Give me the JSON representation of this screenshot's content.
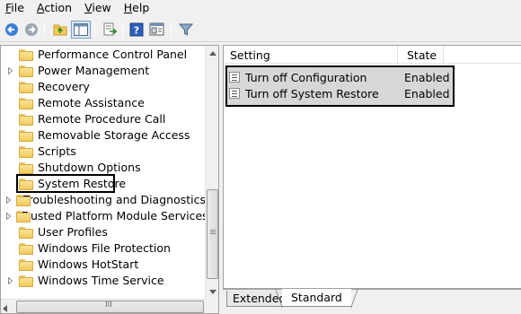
{
  "menu": [
    {
      "label": "File",
      "underline": "F",
      "rest": "ile"
    },
    {
      "label": "Action",
      "underline": "A",
      "rest": "ction"
    },
    {
      "label": "View",
      "underline": "V",
      "rest": "iew"
    },
    {
      "label": "Help",
      "underline": "H",
      "rest": "elp"
    }
  ],
  "toolbar": {
    "buttons": [
      "back-icon",
      "forward-icon",
      "up-folder-icon",
      "show-hide-tree-icon",
      "export-list-icon",
      "help-icon",
      "properties-icon",
      "filter-icon"
    ]
  },
  "tree": {
    "items": [
      {
        "label": "Performance Control Panel",
        "expandable": false
      },
      {
        "label": "Power Management",
        "expandable": true
      },
      {
        "label": "Recovery",
        "expandable": false
      },
      {
        "label": "Remote Assistance",
        "expandable": false
      },
      {
        "label": "Remote Procedure Call",
        "expandable": false
      },
      {
        "label": "Removable Storage Access",
        "expandable": false
      },
      {
        "label": "Scripts",
        "expandable": false
      },
      {
        "label": "Shutdown Options",
        "expandable": false
      },
      {
        "label": "System Restore",
        "expandable": false,
        "selected": true
      },
      {
        "label": "Troubleshooting and Diagnostics",
        "expandable": true
      },
      {
        "label": "Trusted Platform Module Services",
        "expandable": true
      },
      {
        "label": "User Profiles",
        "expandable": false
      },
      {
        "label": "Windows File Protection",
        "expandable": false
      },
      {
        "label": "Windows HotStart",
        "expandable": false
      },
      {
        "label": "Windows Time Service",
        "expandable": true
      }
    ],
    "hscroll_grip": "III"
  },
  "list": {
    "columns": {
      "setting": "Setting",
      "state": "State"
    },
    "rows": [
      {
        "setting": "Turn off Configuration",
        "state": "Enabled"
      },
      {
        "setting": "Turn off System Restore",
        "state": "Enabled"
      }
    ]
  },
  "tabs": {
    "extended": "Extended",
    "standard": "Standard"
  }
}
